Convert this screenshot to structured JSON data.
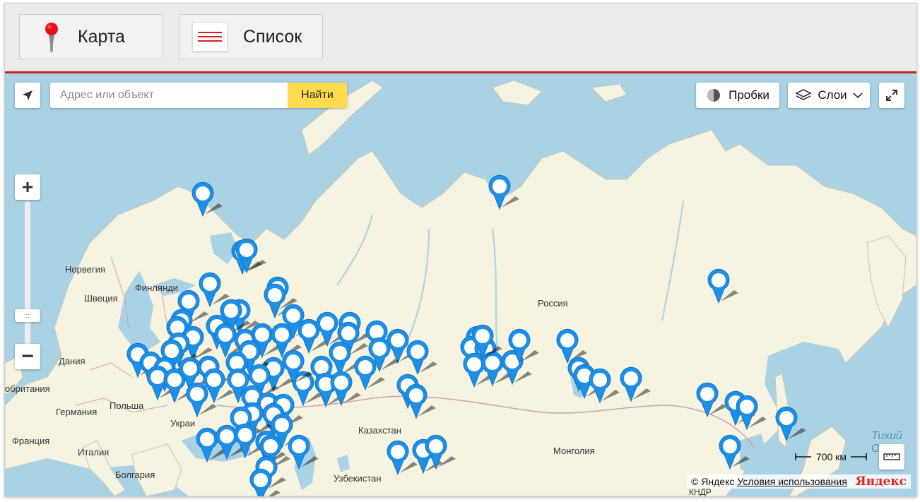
{
  "tabs": {
    "map_label": "Карта",
    "list_label": "Список"
  },
  "search": {
    "placeholder": "Адрес или объект",
    "button_label": "Найти"
  },
  "map_controls": {
    "traffic_label": "Пробки",
    "layers_label": "Слои",
    "zoom_in": "+",
    "zoom_out": "−",
    "zoom_level_fraction": 0.18
  },
  "scale_bar": {
    "label": "700 км"
  },
  "attribution": {
    "copyright": "© Яндекс",
    "terms_link": "Условия использования",
    "logo_text": "Яндекс"
  },
  "map_labels": {
    "norway": "Норвегия",
    "finland": "Финлянди",
    "sweden": "Швеция",
    "denmark": "Дания",
    "britain": "обритания",
    "germany": "Германия",
    "poland": "Польша",
    "ukraine": "Украи",
    "france": "Франция",
    "italy": "Италия",
    "bulgaria": "Болгария",
    "russia": "Россия",
    "kazakhstan": "Казахстан",
    "mongolia": "Монголия",
    "uzbekistan": "Узбекистан",
    "pacific": "Тихий",
    "pacific_cut": "О",
    "kndr": "КНДР"
  },
  "colors": {
    "water": "#a9d2e5",
    "land": "#f7f3e1",
    "accent_red": "#c9201c",
    "marker": "#1d8fe6",
    "search_button": "#ffdb4d"
  },
  "icons": {
    "map_tab": "red-map-pin-icon",
    "list_tab": "list-lines-icon",
    "locate": "geolocation-arrow-icon",
    "traffic": "traffic-light-icon",
    "layers": "layers-icon",
    "fullscreen": "fullscreen-expand-icon",
    "ruler": "ruler-icon",
    "marker": "map-marker-icon"
  }
}
